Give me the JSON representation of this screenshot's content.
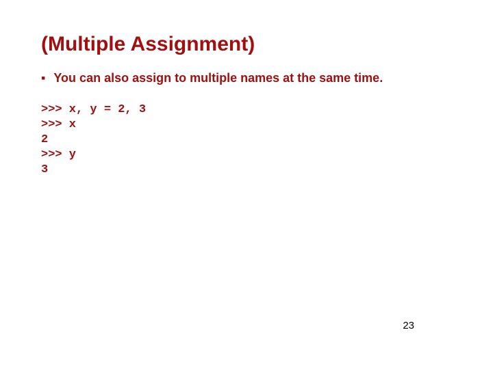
{
  "title": "(Multiple Assignment)",
  "bullet_marker": "▪",
  "bullet_text": "You can also assign to multiple names at the same time.",
  "code": ">>> x, y = 2, 3\n>>> x\n2\n>>> y\n3",
  "page_number": "23"
}
